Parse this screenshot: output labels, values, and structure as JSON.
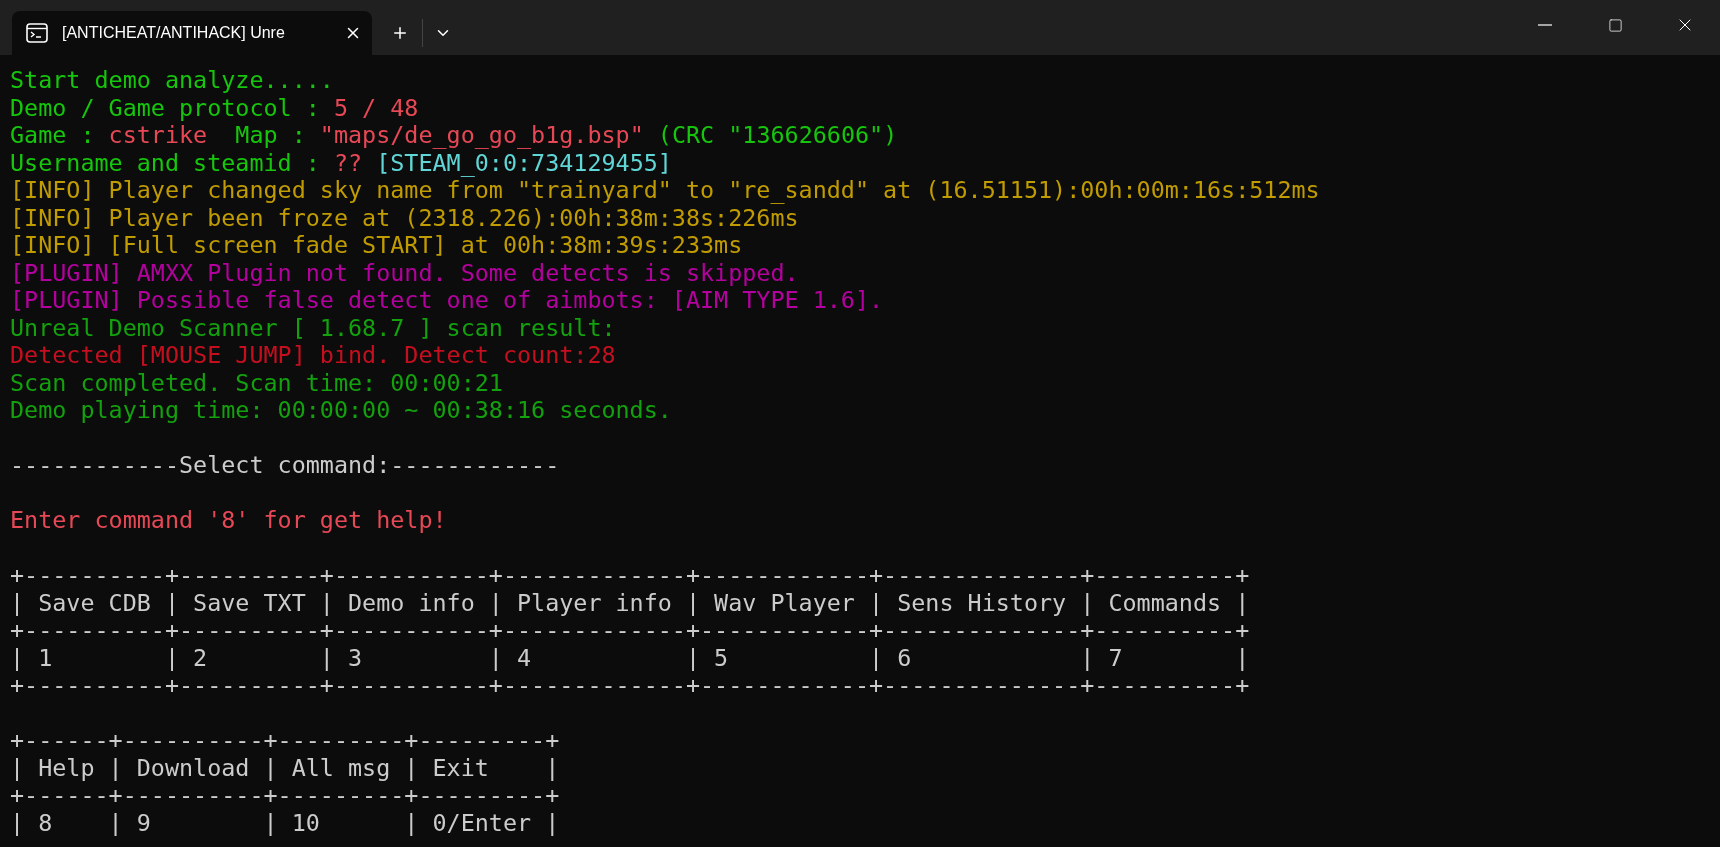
{
  "tab": {
    "title": "[ANTICHEAT/ANTIHACK] Unre"
  },
  "lines": [
    {
      "kind": "text",
      "segments": [
        {
          "text": "Start demo analyze.....",
          "color": "#16c60c"
        }
      ]
    },
    {
      "kind": "text",
      "segments": [
        {
          "text": "Demo / Game protocol : ",
          "color": "#16c60c"
        },
        {
          "text": "5 / 48",
          "color": "#e74856"
        }
      ]
    },
    {
      "kind": "text",
      "segments": [
        {
          "text": "Game : ",
          "color": "#16c60c"
        },
        {
          "text": "cstrike",
          "color": "#e74856"
        },
        {
          "text": "  Map : ",
          "color": "#16c60c"
        },
        {
          "text": "\"maps/de_go_go_b1g.bsp\"",
          "color": "#e74856"
        },
        {
          "text": " (CRC \"136626606\")",
          "color": "#16c60c"
        }
      ]
    },
    {
      "kind": "text",
      "segments": [
        {
          "text": "Username and steamid : ",
          "color": "#16c60c"
        },
        {
          "text": "??",
          "color": "#e74856"
        },
        {
          "text": " [STEAM_0:0:734129455]",
          "color": "#61d6d6"
        }
      ]
    },
    {
      "kind": "text",
      "segments": [
        {
          "text": "[INFO] Player changed sky name from \"trainyard\" to \"re_sandd\" at (16.51151):00h:00m:16s:512ms",
          "color": "#c19c00"
        }
      ]
    },
    {
      "kind": "text",
      "segments": [
        {
          "text": "[INFO] Player been froze at (2318.226):00h:38m:38s:226ms",
          "color": "#c19c00"
        }
      ]
    },
    {
      "kind": "text",
      "segments": [
        {
          "text": "[INFO] [Full screen fade START] at 00h:38m:39s:233ms",
          "color": "#c19c00"
        }
      ]
    },
    {
      "kind": "text",
      "segments": [
        {
          "text": "[PLUGIN] AMXX Plugin not found. Some detects is skipped.",
          "color": "#b4009e"
        }
      ]
    },
    {
      "kind": "text",
      "segments": [
        {
          "text": "[PLUGIN] Possible false detect one of aimbots: [AIM TYPE 1.6].",
          "color": "#b4009e"
        }
      ]
    },
    {
      "kind": "text",
      "segments": [
        {
          "text": "Unreal Demo Scanner [ 1.68.7 ] scan result:",
          "color": "#13a10e"
        }
      ]
    },
    {
      "kind": "text",
      "segments": [
        {
          "text": "Detected [MOUSE JUMP] bind. Detect count:28",
          "color": "#c50f1f"
        }
      ]
    },
    {
      "kind": "text",
      "segments": [
        {
          "text": "Scan completed. Scan time: 00:00:21",
          "color": "#13a10e"
        }
      ]
    },
    {
      "kind": "text",
      "segments": [
        {
          "text": "Demo playing time: 00:00:00 ~ 00:38:16 seconds.",
          "color": "#13a10e"
        }
      ]
    },
    {
      "kind": "blank"
    },
    {
      "kind": "text",
      "segments": [
        {
          "text": "------------Select command:------------",
          "color": "#cccccc"
        }
      ]
    },
    {
      "kind": "blank"
    },
    {
      "kind": "text",
      "segments": [
        {
          "text": "Enter command '8' for get help!",
          "color": "#e74856"
        }
      ]
    },
    {
      "kind": "blank"
    },
    {
      "kind": "text",
      "segments": [
        {
          "text": "+----------+----------+-----------+-------------+------------+--------------+----------+",
          "color": "#cccccc"
        }
      ]
    },
    {
      "kind": "text",
      "segments": [
        {
          "text": "| Save CDB | Save TXT | Demo info | Player info | Wav Player | Sens History | Commands |",
          "color": "#cccccc"
        }
      ]
    },
    {
      "kind": "text",
      "segments": [
        {
          "text": "+----------+----------+-----------+-------------+------------+--------------+----------+",
          "color": "#cccccc"
        }
      ]
    },
    {
      "kind": "text",
      "segments": [
        {
          "text": "| 1        | 2        | 3         | 4           | 5          | 6            | 7        |",
          "color": "#cccccc"
        }
      ]
    },
    {
      "kind": "text",
      "segments": [
        {
          "text": "+----------+----------+-----------+-------------+------------+--------------+----------+",
          "color": "#cccccc"
        }
      ]
    },
    {
      "kind": "blank"
    },
    {
      "kind": "text",
      "segments": [
        {
          "text": "+------+----------+---------+---------+",
          "color": "#cccccc"
        }
      ]
    },
    {
      "kind": "text",
      "segments": [
        {
          "text": "| Help | Download | All msg | Exit    |",
          "color": "#cccccc"
        }
      ]
    },
    {
      "kind": "text",
      "segments": [
        {
          "text": "+------+----------+---------+---------+",
          "color": "#cccccc"
        }
      ]
    },
    {
      "kind": "text",
      "segments": [
        {
          "text": "| 8    | 9        | 10      | 0/Enter |",
          "color": "#cccccc"
        }
      ]
    }
  ]
}
